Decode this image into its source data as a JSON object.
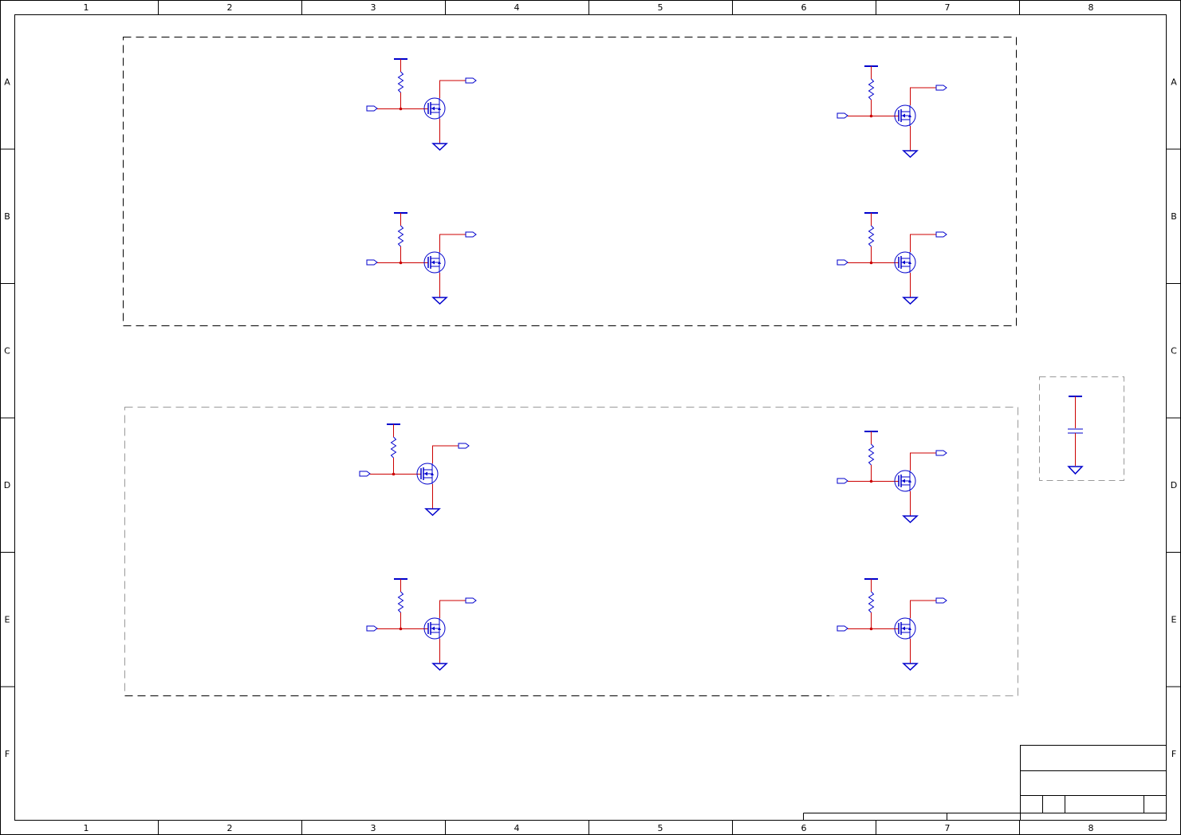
{
  "sheet": {
    "columns": [
      "1",
      "2",
      "3",
      "4",
      "5",
      "6",
      "7",
      "8"
    ],
    "rows": [
      "A",
      "B",
      "C",
      "D",
      "E",
      "F"
    ]
  },
  "colors": {
    "frame": "#000000",
    "wire": "#cc0000",
    "component": "#0000cc",
    "group_border_dark": "#000000",
    "group_border_light": "#999999",
    "background": "#ffffff"
  },
  "circuits": {
    "groups": [
      {
        "name": "upper-switch-group",
        "border": "dark"
      },
      {
        "name": "lower-switch-group",
        "border": "light"
      },
      {
        "name": "decoupling-group",
        "border": "light"
      }
    ],
    "switch_stage": {
      "parts": [
        "power-rail-icon",
        "resistor-icon",
        "mosfet-icon",
        "ground-icon",
        "input-port-icon",
        "output-port-icon"
      ],
      "count": 8
    },
    "decoupling": {
      "parts": [
        "power-rail-icon",
        "capacitor-icon",
        "ground-icon"
      ],
      "count": 1
    }
  },
  "title_block": {
    "fields": [
      "title-field",
      "document-field",
      "size-field",
      "number-field",
      "revision-field",
      "sheet-field"
    ]
  }
}
